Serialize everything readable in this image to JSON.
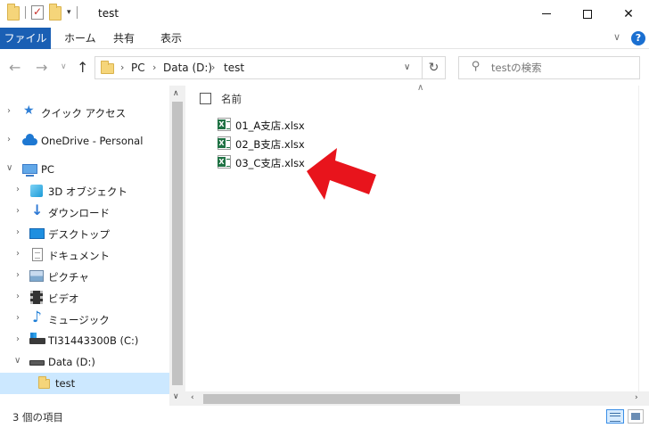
{
  "window": {
    "title": "test",
    "minimize_glyph": "─",
    "maximize_glyph": "☐",
    "close_glyph": "✕"
  },
  "ribbon": {
    "tabs": [
      "ファイル",
      "ホーム",
      "共有",
      "表示"
    ],
    "collapse_glyph": "∨",
    "help_glyph": "?"
  },
  "address": {
    "crumbs": [
      "PC",
      "Data (D:)",
      "test"
    ],
    "separator": "›",
    "dropdown_glyph": "∨",
    "refresh_glyph": "↻"
  },
  "search": {
    "placeholder": "testの検索"
  },
  "navpane": {
    "items": [
      {
        "label": "クイック アクセス",
        "icon": "star-icon",
        "expanded": false
      },
      {
        "label": "OneDrive - Personal",
        "icon": "onedrive-icon",
        "expanded": false
      },
      {
        "label": "PC",
        "icon": "pc-icon",
        "expanded": true
      },
      {
        "label": "3D オブジェクト",
        "icon": "3d-objects-icon",
        "expanded": false
      },
      {
        "label": "ダウンロード",
        "icon": "download-icon",
        "expanded": false
      },
      {
        "label": "デスクトップ",
        "icon": "desktop-icon",
        "expanded": false
      },
      {
        "label": "ドキュメント",
        "icon": "documents-icon",
        "expanded": false
      },
      {
        "label": "ピクチャ",
        "icon": "pictures-icon",
        "expanded": false
      },
      {
        "label": "ビデオ",
        "icon": "videos-icon",
        "expanded": false
      },
      {
        "label": "ミュージック",
        "icon": "music-icon",
        "expanded": false
      },
      {
        "label": "TI31443300B (C:)",
        "icon": "drive-c-icon",
        "expanded": false
      },
      {
        "label": "Data (D:)",
        "icon": "drive-d-icon",
        "expanded": true
      },
      {
        "label": "test",
        "icon": "folder-icon",
        "selected": true
      }
    ]
  },
  "content": {
    "column_header": "名前",
    "files": [
      {
        "name": "01_A支店.xlsx",
        "icon": "excel-file-icon"
      },
      {
        "name": "02_B支店.xlsx",
        "icon": "excel-file-icon"
      },
      {
        "name": "03_C支店.xlsx",
        "icon": "excel-file-icon"
      }
    ]
  },
  "status": {
    "item_count": "3 個の項目"
  },
  "colors": {
    "file_tab": "#1a5fb4",
    "selection": "#cce8ff",
    "annotation_arrow": "#e8141c"
  }
}
